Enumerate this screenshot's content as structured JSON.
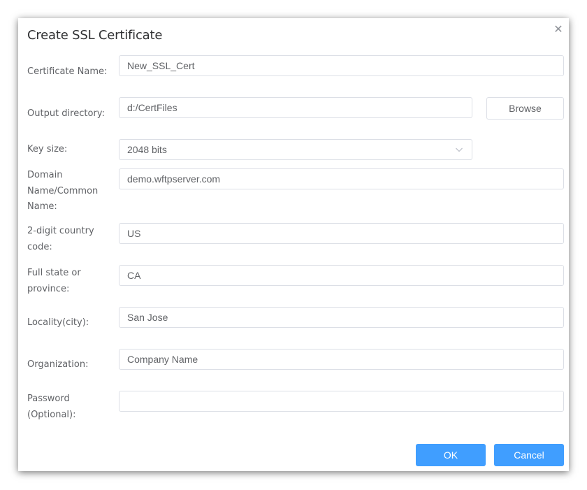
{
  "dialog": {
    "title": "Create SSL Certificate",
    "close_icon": "close-icon"
  },
  "form": {
    "certificate_name": {
      "label": "Certificate Name:",
      "value": "New_SSL_Cert"
    },
    "output_directory": {
      "label": "Output directory:",
      "value": "d:/CertFiles",
      "browse_label": "Browse"
    },
    "key_size": {
      "label": "Key size:",
      "value": "2048 bits",
      "icon": "chevron-down-icon"
    },
    "domain_name": {
      "label": "Domain Name/Common Name:",
      "value": "demo.wftpserver.com"
    },
    "country_code": {
      "label": "2-digit country code:",
      "value": "US"
    },
    "state": {
      "label": "Full state or province:",
      "value": "CA"
    },
    "locality": {
      "label": "Locality(city):",
      "value": "San Jose"
    },
    "organization": {
      "label": "Organization:",
      "value": "Company Name"
    },
    "password": {
      "label": "Password (Optional):",
      "value": ""
    }
  },
  "footer": {
    "ok_label": "OK",
    "cancel_label": "Cancel"
  },
  "colors": {
    "primary": "#409eff",
    "border": "#dcdfe6",
    "label_text": "#606266",
    "title_text": "#303133"
  }
}
